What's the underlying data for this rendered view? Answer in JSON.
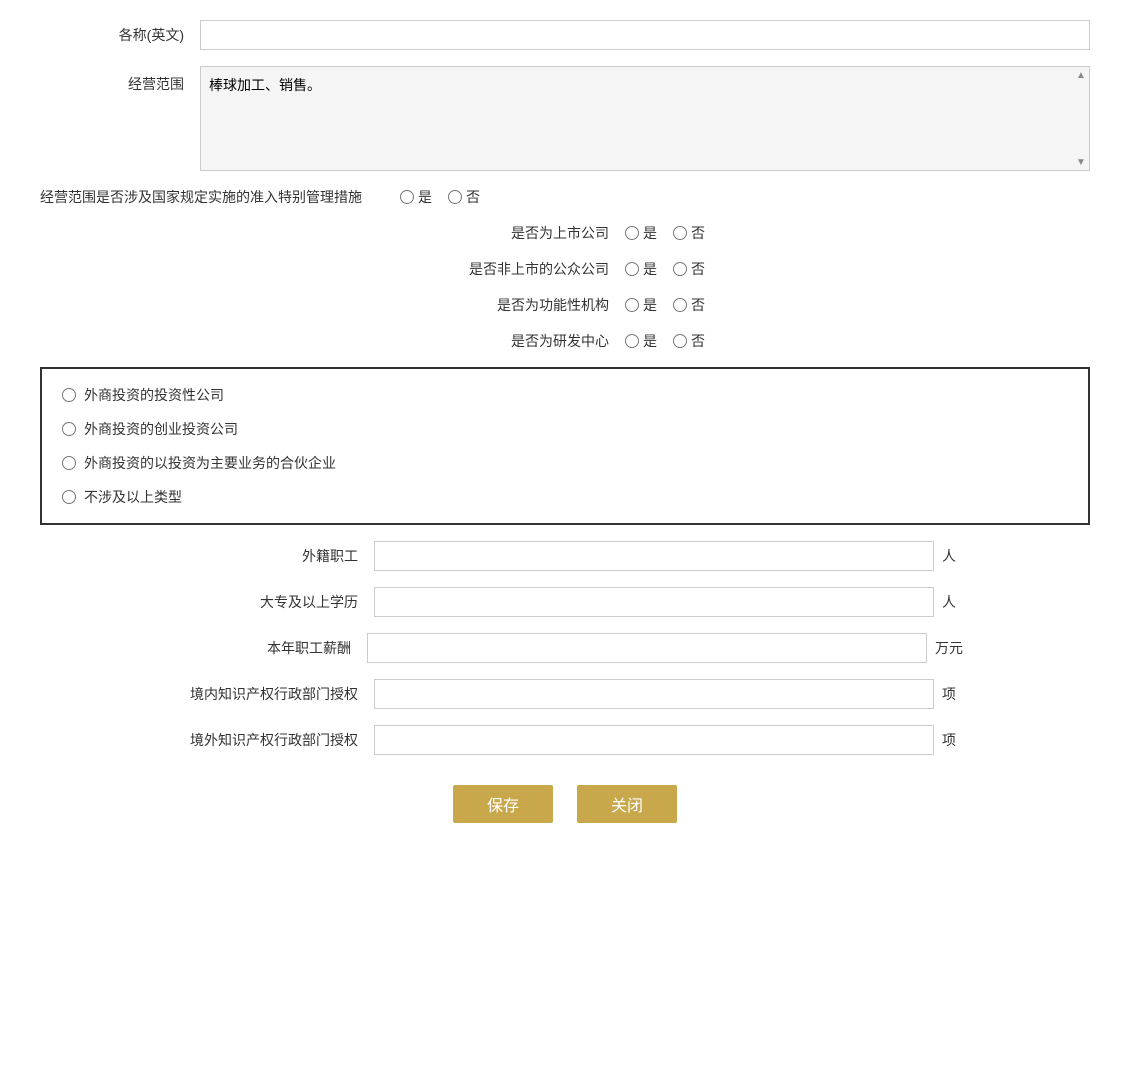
{
  "form": {
    "fields": {
      "name_en_label": "各称(英文)",
      "business_scope_label": "经营范围",
      "business_scope_value": "棒球加工、销售。",
      "special_management_label": "经营范围是否涉及国家规定实施的准入特别管理措施",
      "listed_company_label": "是否为上市公司",
      "non_listed_public_label": "是否非上市的公众公司",
      "functional_institution_label": "是否为功能性机构",
      "rd_center_label": "是否为研发中心",
      "yes_label": "是",
      "no_label": "否",
      "foreign_worker_label": "外籍职工",
      "foreign_worker_unit": "人",
      "college_degree_label": "大专及以上学历",
      "college_degree_unit": "人",
      "salary_label": "本年职工薪酬",
      "salary_unit": "万元",
      "domestic_ip_label": "境内知识产权行政部门授权",
      "domestic_ip_unit": "项",
      "foreign_ip_label": "境外知识产权行政部门授权",
      "foreign_ip_unit": "项"
    },
    "investment_types": [
      "外商投资的投资性公司",
      "外商投资的创业投资公司",
      "外商投资的以投资为主要业务的合伙企业",
      "不涉及以上类型"
    ],
    "buttons": {
      "save": "保存",
      "close": "关闭"
    }
  }
}
